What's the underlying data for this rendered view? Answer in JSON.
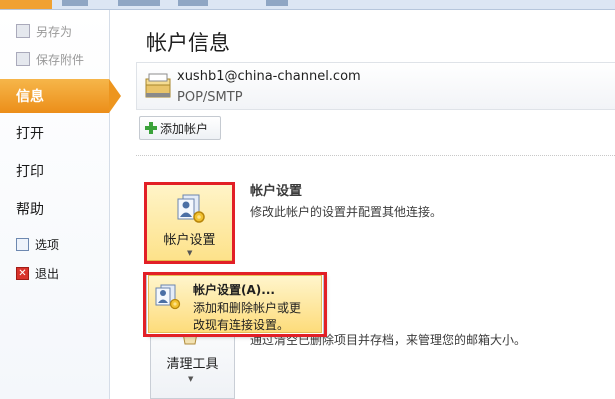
{
  "nav": {
    "save_as": "另存为",
    "save_attachments": "保存附件",
    "info": "信息",
    "open": "打开",
    "print": "打印",
    "help": "帮助",
    "options": "选项",
    "exit": "退出"
  },
  "main": {
    "title": "帐户信息",
    "account": {
      "email": "xushb1@china-channel.com",
      "type": "POP/SMTP"
    },
    "add_account": "添加帐户",
    "account_settings": {
      "button_label": "帐户设置",
      "heading": "帐户设置",
      "description": "修改此帐户的设置并配置其他连接。"
    },
    "dropdown": {
      "title": "帐户设置(A)...",
      "line1": "添加和删除帐户或更",
      "line2": "改现有连接设置。"
    },
    "cleanup": {
      "button_label": "清理工具",
      "description": "通过清空已删除项目并存档，来管理您的邮箱大小。"
    }
  },
  "colors": {
    "accent": "#ec8e19",
    "highlight": "#fde28a",
    "annotation_red": "#e21f26"
  },
  "icons": [
    "save-as-icon",
    "attachment-icon",
    "options-icon",
    "exit-icon",
    "mailbox-icon",
    "plus-icon",
    "account-settings-icon",
    "cleanup-icon",
    "chevron-down-icon"
  ]
}
